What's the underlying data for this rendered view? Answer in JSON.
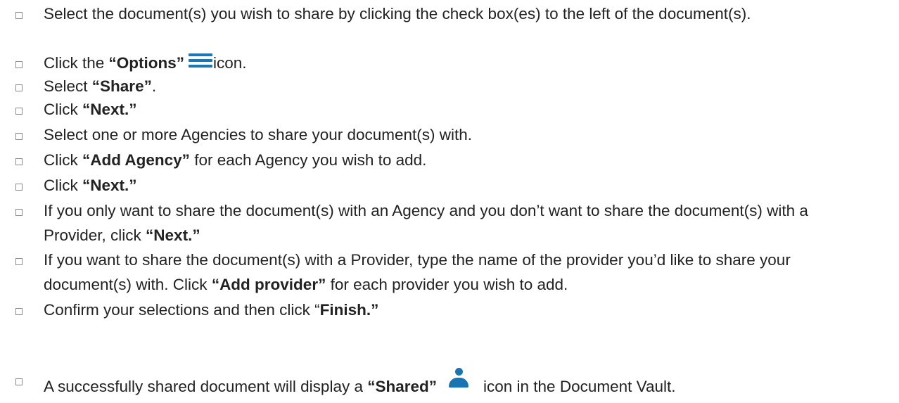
{
  "steps": [
    {
      "segments": [
        {
          "text": "Select the document(s) you wish to share by clicking the check box(es) to the left of the document(s).",
          "bold": false
        }
      ]
    },
    {
      "segments": [
        {
          "text": "Click the ",
          "bold": false
        },
        {
          "text": "“Options”",
          "bold": true
        },
        {
          "icon": "options-menu-icon"
        },
        {
          "text": "icon.",
          "bold": false
        }
      ]
    },
    {
      "segments": [
        {
          "text": "Select ",
          "bold": false
        },
        {
          "text": "“Share”",
          "bold": true
        },
        {
          "text": ".",
          "bold": false
        }
      ]
    },
    {
      "segments": [
        {
          "text": "Click ",
          "bold": false
        },
        {
          "text": "“Next.”",
          "bold": true
        }
      ]
    },
    {
      "segments": [
        {
          "text": "Select one or more Agencies to share your document(s) with.",
          "bold": false
        }
      ]
    },
    {
      "segments": [
        {
          "text": "Click ",
          "bold": false
        },
        {
          "text": "“Add Agency”",
          "bold": true
        },
        {
          "text": " for each Agency you wish to add.",
          "bold": false
        }
      ]
    },
    {
      "segments": [
        {
          "text": "Click ",
          "bold": false
        },
        {
          "text": "“Next.”",
          "bold": true
        }
      ]
    },
    {
      "segments": [
        {
          "text": "If you only want to share the document(s) with an Agency and you don’t want to share the document(s) with a Provider, click ",
          "bold": false
        },
        {
          "text": "“Next.”",
          "bold": true
        }
      ]
    },
    {
      "segments": [
        {
          "text": "If you want to share the document(s) with a Provider, type the name of the provider you’d like to share your document(s) with. Click ",
          "bold": false
        },
        {
          "text": "“Add provider”",
          "bold": true
        },
        {
          "text": " for each provider you wish to add.",
          "bold": false
        }
      ]
    },
    {
      "segments": [
        {
          "text": "Confirm your selections and then click “",
          "bold": false
        },
        {
          "text": "Finish.”",
          "bold": true
        }
      ]
    },
    {
      "segments": [
        {
          "text": "A successfully shared document will display a ",
          "bold": false
        },
        {
          "text": "“Shared”",
          "bold": true
        },
        {
          "icon": "shared-person-icon"
        },
        {
          "text": "icon in the Document Vault.",
          "bold": false
        }
      ]
    }
  ],
  "colors": {
    "text": "#222222",
    "icon_blue": "#1978b8",
    "checkbox_border": "#8a8a8a"
  }
}
